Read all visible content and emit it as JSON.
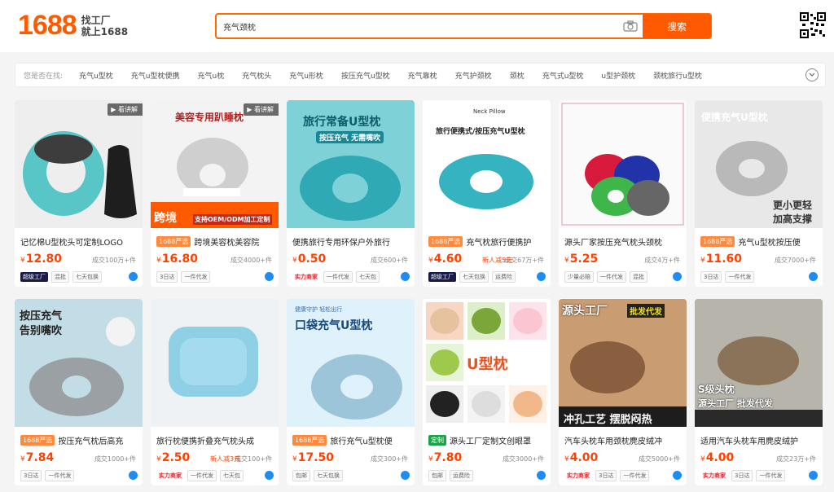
{
  "header": {
    "logo_num": "1688",
    "logo_line1": "找工厂",
    "logo_line2": "就上1688",
    "search_value": "充气颈枕",
    "search_btn": "搜索"
  },
  "keywords": {
    "lead": "您是否在找:",
    "items": [
      "充气u型枕",
      "充气u型枕便携",
      "充气u枕",
      "充气枕头",
      "充气u形枕",
      "按压充气u型枕",
      "充气靠枕",
      "充气护颈枕",
      "颈枕",
      "充气式u型枕",
      "u型护颈枕",
      "颈枕旅行u型枕"
    ]
  },
  "products": [
    {
      "title": "记忆棉U型枕头可定制LOGO",
      "tag": "",
      "price": "12.80",
      "promo": "",
      "sold": "成交100万+件",
      "badges": [
        "超级工厂",
        "混批",
        "七天包换"
      ],
      "video": "看讲解"
    },
    {
      "title": "跨境美容枕美容院",
      "tag": "1688严选",
      "price": "16.80",
      "promo": "",
      "sold": "成交4000+件",
      "badges": [
        "3日达",
        "一件代发"
      ],
      "video": "看讲解"
    },
    {
      "title": "便携旅行专用环保户外旅行",
      "tag": "",
      "price": "0.50",
      "promo": "",
      "sold": "成交600+件",
      "badges": [
        "实力商家",
        "一件代发",
        "七天包"
      ],
      "video": ""
    },
    {
      "title": "充气枕旅行便携护",
      "tag": "1688严选",
      "price": "4.60",
      "promo": "新人减5元",
      "sold": "成交67万+件",
      "badges": [
        "超级工厂",
        "七天包换",
        "运费险"
      ],
      "video": ""
    },
    {
      "title": "源头厂家按压充气枕头颈枕",
      "tag": "",
      "price": "5.25",
      "promo": "",
      "sold": "成交4万+件",
      "badges": [
        "少量必赔",
        "一件代发",
        "混批"
      ],
      "video": ""
    },
    {
      "title": "充气u型枕按压便",
      "tag": "1688严选",
      "price": "11.60",
      "promo": "",
      "sold": "成交7000+件",
      "badges": [
        "3日达",
        "一件代发"
      ],
      "video": ""
    },
    {
      "title": "按压充气枕后高充",
      "tag": "1688严选",
      "price": "7.84",
      "promo": "",
      "sold": "成交1000+件",
      "badges": [
        "3日达",
        "一件代发"
      ],
      "video": ""
    },
    {
      "title": "旅行枕便携折叠充气枕头成",
      "tag": "",
      "price": "2.50",
      "promo": "新人减3元",
      "sold": "成交100+件",
      "badges": [
        "实力商家",
        "一件代发",
        "七天包"
      ],
      "video": ""
    },
    {
      "title": "旅行充气u型枕便",
      "tag": "1688严选",
      "price": "17.50",
      "promo": "",
      "sold": "成交300+件",
      "badges": [
        "包邮",
        "七天包换"
      ],
      "video": ""
    },
    {
      "title": "源头工厂定制文创眼罩",
      "tag": "定制",
      "price": "7.80",
      "promo": "",
      "sold": "成交3000+件",
      "badges": [
        "包邮",
        "运费险"
      ],
      "video": ""
    },
    {
      "title": "汽车头枕车用颈枕麂皮绒冲",
      "tag": "",
      "price": "4.00",
      "promo": "",
      "sold": "成交5000+件",
      "badges": [
        "实力商家",
        "3日达",
        "一件代发"
      ],
      "video": ""
    },
    {
      "title": "适用汽车头枕车用麂皮绒护",
      "tag": "",
      "price": "4.00",
      "promo": "",
      "sold": "成交23万+件",
      "badges": [
        "实力商家",
        "3日达",
        "一件代发"
      ],
      "video": ""
    }
  ],
  "overlays": {
    "p2_title": "美容专用趴睡枕",
    "p2_cross": "跨境",
    "p2_oem": "支持OEM/ODM加工定制",
    "p3_title": "旅行常备U型枕",
    "p3_sub": "按压充气 无需嘴吹",
    "p4_head": "Neck Pillow",
    "p4_title": "旅行便携式/按压充气U型枕",
    "p6_title": "便携充气U型枕",
    "p6_sub1": "更小更轻",
    "p6_sub2": "加高支撑",
    "p7_title": "按压充气",
    "p7_sub": "告别嘴吹",
    "p9_title": "口袋充气U型枕",
    "p9_top": "健康守护 轻松出行",
    "p10_big": "U型枕",
    "p11_top": "源头工厂",
    "p11_bar": "批发代发",
    "p11_bottom": "冲孔工艺 摆脱闷热",
    "p12_title": "S级头枕",
    "p12_sub": "源头工厂 批发代发"
  }
}
